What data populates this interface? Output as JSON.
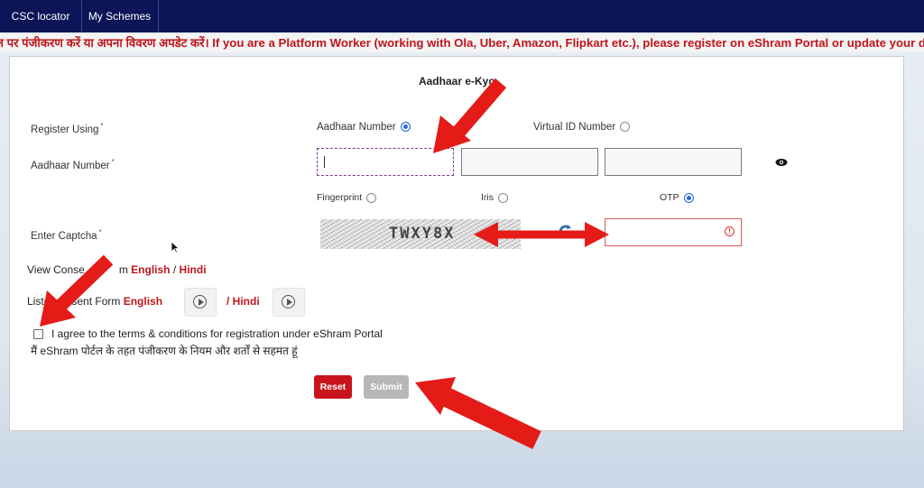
{
  "nav": {
    "items": [
      {
        "label": "CSC locator"
      },
      {
        "label": "My Schemes"
      }
    ]
  },
  "ticker": {
    "text": "ल पर पंजीकरण करें या अपना विवरण अपडेट करें। If you are a Platform Worker (working with Ola, Uber, Amazon, Flipkart etc.), please register on eShram Portal or update your details if"
  },
  "form": {
    "title": "Aadhaar e-Kyc",
    "register_using_label": "Register Using",
    "required_mark": "*",
    "options": {
      "aadhaar_number": "Aadhaar Number",
      "virtual_id": "Virtual ID Number"
    },
    "selected_option": "Aadhaar Number",
    "aadhaar_label": "Aadhaar Number",
    "auth_modes": {
      "fingerprint": "Fingerprint",
      "iris": "Iris",
      "otp": "OTP"
    },
    "selected_auth_mode": "OTP",
    "captcha_label": "Enter Captcha",
    "captcha_text": "TWXY8X",
    "consent_prefix": "View Conse",
    "consent_suffix": "m",
    "english_link": "English",
    "separator": "/",
    "hindi_link": "Hindi",
    "listen_prefix": "Liste",
    "listen_suffix": "sent Form",
    "listen_separator": "/ ",
    "agree_text_en": "I agree to the terms & conditions for registration under eShram Portal",
    "agree_text_hi": "मैं eShram पोर्टल के तहत पंजीकरण के नियम और शर्तों से सहमत हूं",
    "reset_label": "Reset",
    "submit_label": "Submit"
  },
  "colors": {
    "nav_bg": "#0b1557",
    "accent_red": "#c0151c",
    "arrow_red": "#e41b17",
    "radio_blue": "#2b66d9"
  },
  "icons": {
    "show_password": "eye-icon",
    "refresh": "refresh-icon",
    "error": "error-icon",
    "play": "play-icon"
  }
}
